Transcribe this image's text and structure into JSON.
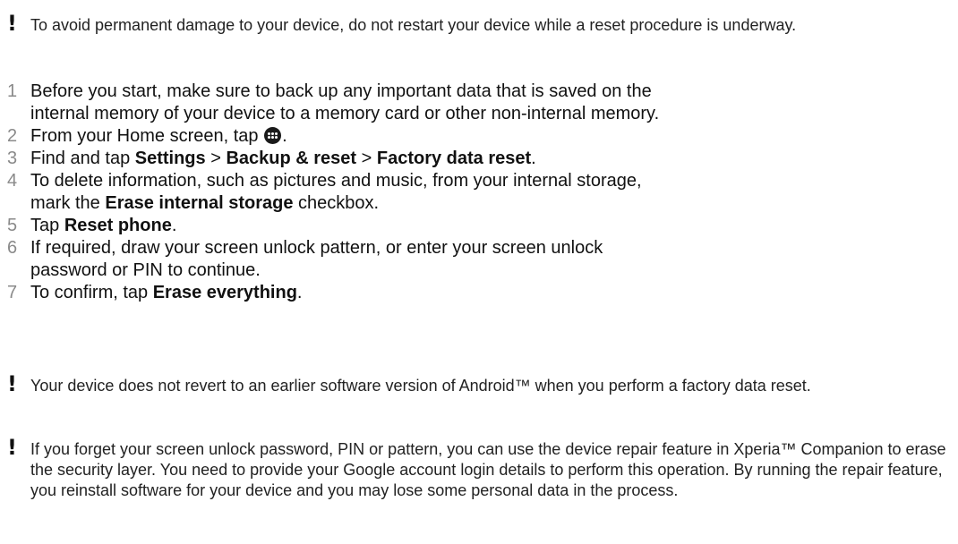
{
  "top_note": {
    "text": "To avoid permanent damage to your device, do not restart your device while a reset procedure is underway."
  },
  "steps": [
    {
      "number": "1",
      "lines": [
        "Before you start, make sure to back up any important data that is saved on the",
        "internal memory of your device to a memory card or other non-internal memory."
      ]
    },
    {
      "number": "2",
      "before": "From your Home screen, tap ",
      "icon": "apps-menu-icon",
      "after": "."
    },
    {
      "number": "3",
      "pre": "Find and tap ",
      "path": [
        "Settings",
        "Backup & reset",
        "Factory data reset"
      ],
      "separator": " > ",
      "end": "."
    },
    {
      "number": "4",
      "line1": "To delete information, such as pictures and music, from your internal storage,",
      "line2_pre": "mark the ",
      "line2_bold": "Erase internal storage",
      "line2_post": " checkbox."
    },
    {
      "number": "5",
      "pre": "Tap ",
      "bold": "Reset phone",
      "post": "."
    },
    {
      "number": "6",
      "lines": [
        "If required, draw your screen unlock pattern, or enter your screen unlock",
        "password or PIN to continue."
      ]
    },
    {
      "number": "7",
      "pre": "To confirm, tap ",
      "bold": "Erase everything",
      "post": "."
    }
  ],
  "note_android": {
    "text": "Your device does not revert to an earlier software version of Android™ when you perform a factory data reset."
  },
  "note_forget": {
    "text": "If you forget your screen unlock password, PIN or pattern, you can use the device repair feature in Xperia™ Companion to erase the security layer. You need to provide your Google account login details to perform this operation. By running the repair feature, you reinstall software for your device and you may lose some personal data in the process."
  },
  "note_icon": "!"
}
